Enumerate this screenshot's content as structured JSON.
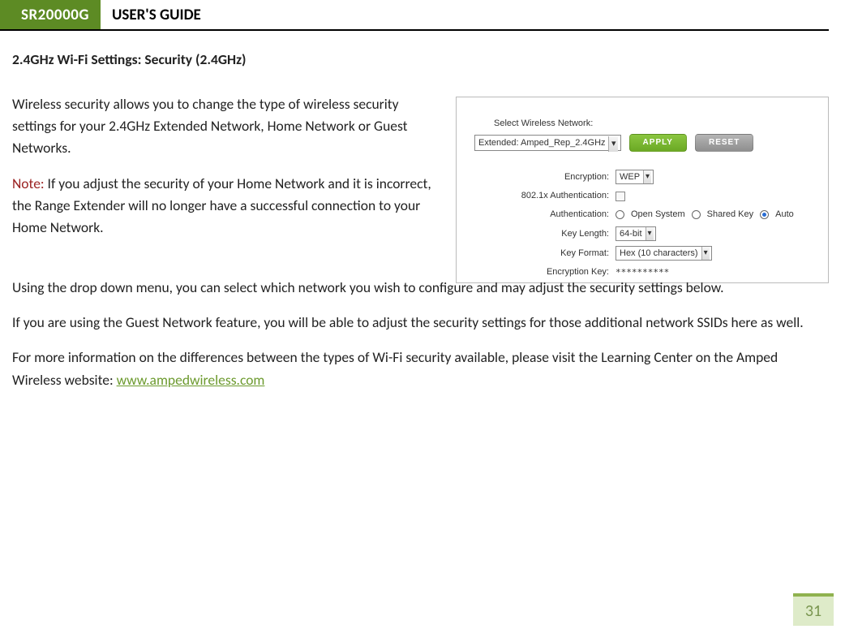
{
  "header": {
    "product": "SR20000G",
    "title": "USER'S GUIDE"
  },
  "heading": "2.4GHz Wi-Fi Settings: Security (2.4GHz)",
  "paragraphs": {
    "p1": "Wireless security allows you to change the type of wireless security settings for your 2.4GHz Extended Network, Home Network or Guest Networks.",
    "note_label": "Note:",
    "note_text": " If you adjust the security of your Home Network and it is incorrect, the Range Extender will no longer have a successful connection to your Home Network.",
    "p3": "Using the drop down menu, you can select which network you wish to configure and may adjust the security settings below.",
    "p4": "If you are using the Guest Network feature, you will be able to adjust the security settings for those additional network SSIDs here as well.",
    "p5_pre": "For more information on the differences between the types of Wi-Fi security available, please visit the Learning Center on the Amped Wireless website: ",
    "link_text": "www.ampedwireless.com"
  },
  "page_number": "31",
  "screenshot": {
    "select_label": "Select Wireless Network:",
    "network_value": "Extended: Amped_Rep_2.4GHz",
    "apply": "APPLY",
    "reset": "RESET",
    "rows": {
      "encryption": {
        "label": "Encryption:",
        "value": "WEP"
      },
      "dot1x": {
        "label": "802.1x Authentication:"
      },
      "auth": {
        "label": "Authentication:",
        "opt1": "Open System",
        "opt2": "Shared Key",
        "opt3": "Auto"
      },
      "keylen": {
        "label": "Key Length:",
        "value": "64-bit"
      },
      "keyfmt": {
        "label": "Key Format:",
        "value": "Hex (10 characters)"
      },
      "enckey": {
        "label": "Encryption Key:",
        "value": "**********"
      }
    }
  }
}
